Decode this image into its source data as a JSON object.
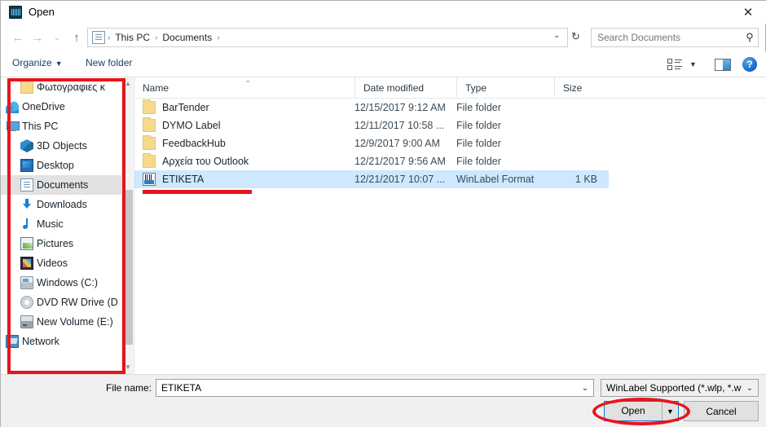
{
  "window": {
    "title": "Open",
    "app_icon": "winlabel-app-icon",
    "close_label": "✕"
  },
  "nav": {
    "back": "←",
    "forward": "→",
    "recent": "⌄",
    "up": "↑",
    "address_icon": "documents-icon",
    "breadcrumbs": [
      "This PC",
      "Documents"
    ],
    "separator": "›",
    "dropdown_caret": "⌄",
    "refresh": "↻"
  },
  "search": {
    "placeholder": "Search Documents",
    "icon": "search-icon",
    "value": ""
  },
  "commandbar": {
    "organize_label": "Organize",
    "organize_caret": "▼",
    "new_folder_label": "New folder",
    "view_icon": "list-view-icon",
    "view_caret": "▼",
    "preview_icon": "preview-pane-icon",
    "help_icon": "help-icon",
    "help_glyph": "?"
  },
  "sidebar": {
    "items": [
      {
        "label": "Φωτογραφιες κ",
        "icon": "folder-icon",
        "icon_class": "ic-folder",
        "level": 1,
        "selected": false
      },
      {
        "label": "OneDrive",
        "icon": "onedrive-icon",
        "icon_class": "ic-onedrive",
        "level": 0,
        "selected": false
      },
      {
        "label": "This PC",
        "icon": "this-pc-icon",
        "icon_class": "ic-pc",
        "level": 0,
        "selected": false
      },
      {
        "label": "3D Objects",
        "icon": "3d-objects-icon",
        "icon_class": "ic-3d",
        "level": 1,
        "selected": false
      },
      {
        "label": "Desktop",
        "icon": "desktop-icon",
        "icon_class": "ic-desktop",
        "level": 1,
        "selected": false
      },
      {
        "label": "Documents",
        "icon": "documents-icon",
        "icon_class": "ic-docs",
        "level": 1,
        "selected": true
      },
      {
        "label": "Downloads",
        "icon": "downloads-icon",
        "icon_class": "ic-downloads",
        "level": 1,
        "selected": false
      },
      {
        "label": "Music",
        "icon": "music-icon",
        "icon_class": "ic-music",
        "level": 1,
        "selected": false
      },
      {
        "label": "Pictures",
        "icon": "pictures-icon",
        "icon_class": "ic-pictures",
        "level": 1,
        "selected": false
      },
      {
        "label": "Videos",
        "icon": "videos-icon",
        "icon_class": "ic-videos",
        "level": 1,
        "selected": false
      },
      {
        "label": "Windows (C:)",
        "icon": "hard-drive-icon",
        "icon_class": "ic-drive",
        "level": 1,
        "selected": false
      },
      {
        "label": "DVD RW Drive (D",
        "icon": "dvd-drive-icon",
        "icon_class": "ic-dvd",
        "level": 1,
        "selected": false
      },
      {
        "label": "New Volume (E:)",
        "icon": "volume-drive-icon",
        "icon_class": "ic-newvol",
        "level": 1,
        "selected": false
      },
      {
        "label": "Network",
        "icon": "network-icon",
        "icon_class": "ic-network",
        "level": 0,
        "selected": false
      }
    ],
    "scrollbar": {
      "up_glyph": "▲",
      "down_glyph": "▼"
    }
  },
  "filelist": {
    "columns": [
      {
        "key": "name",
        "label": "Name",
        "sorted": true,
        "sort_glyph": "⌃"
      },
      {
        "key": "date",
        "label": "Date modified"
      },
      {
        "key": "type",
        "label": "Type"
      },
      {
        "key": "size",
        "label": "Size"
      }
    ],
    "rows": [
      {
        "name": "BarTender",
        "date": "12/15/2017 9:12 AM",
        "type": "File folder",
        "size": "",
        "icon": "folder-icon",
        "icon_class": "row-folder",
        "selected": false
      },
      {
        "name": "DYMO Label",
        "date": "12/11/2017 10:58 ...",
        "type": "File folder",
        "size": "",
        "icon": "folder-icon",
        "icon_class": "row-folder",
        "selected": false
      },
      {
        "name": "FeedbackHub",
        "date": "12/9/2017 9:00 AM",
        "type": "File folder",
        "size": "",
        "icon": "folder-icon",
        "icon_class": "row-folder",
        "selected": false
      },
      {
        "name": "Αρχεία του Outlook",
        "date": "12/21/2017 9:56 AM",
        "type": "File folder",
        "size": "",
        "icon": "folder-icon",
        "icon_class": "row-folder",
        "selected": false
      },
      {
        "name": "ETIKETA",
        "date": "12/21/2017 10:07 ...",
        "type": "WinLabel Format",
        "size": "1 KB",
        "icon": "winlabel-file-icon",
        "icon_class": "row-wlp",
        "selected": true
      }
    ]
  },
  "footer": {
    "filename_label": "File name:",
    "filename_value": "ETIKETA",
    "filename_placeholder": "File name",
    "filename_caret": "⌄",
    "filetype_value": "WinLabel Supported (*.wlp, *.w",
    "filetype_caret": "⌄",
    "open_label": "Open",
    "open_split_caret": "▼",
    "cancel_label": "Cancel"
  },
  "annotations": {
    "color": "#e8141c",
    "sidebar_highlight": "red-rectangle-around-navigation-pane",
    "etiketa_underline": "red-underline-under-etiketa-row",
    "open_ellipse": "red-ellipse-around-open-button"
  }
}
